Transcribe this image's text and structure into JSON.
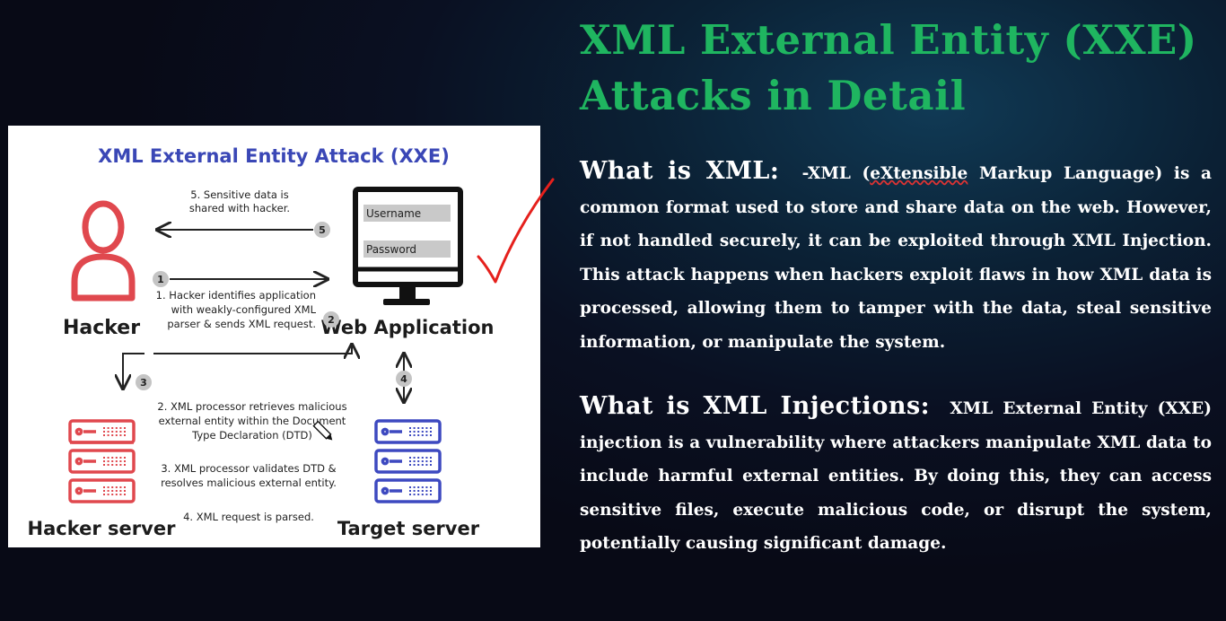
{
  "slide": {
    "title_line1": "XML External Entity (XXE)",
    "title_line2": "Attacks in Detail",
    "section1": {
      "heading": "What is XML:",
      "lead": "-XML (",
      "underlined": "eXtensible",
      "body": " Markup Language) is a common format used to store and share data on the web. However, if not handled securely, it can be exploited through XML Injection. This attack happens when hackers exploit flaws in how XML data is processed, allowing them to tamper with the data, steal sensitive information, or manipulate the system."
    },
    "section2": {
      "heading": "What is XML Injections:",
      "body": "XML External Entity (XXE) injection is a vulnerability where attackers manipulate XML data to include harmful external entities. By doing this, they can access sensitive files, execute malicious code, or disrupt the system, potentially causing significant damage."
    }
  },
  "diagram": {
    "title": "XML External Entity Attack (XXE)",
    "nodes": {
      "hacker": "Hacker",
      "web_app": "Web Application",
      "hacker_server": "Hacker server",
      "target_server": "Target server"
    },
    "login": {
      "username": "Username",
      "password": "Password"
    },
    "steps": {
      "n1": "1",
      "n2": "2",
      "n3": "3",
      "n4": "4",
      "n5": "5",
      "s1_l1": "1. Hacker identifies application",
      "s1_l2": "with weakly-configured XML",
      "s1_l3": "parser & sends XML request.",
      "s2_l1": "2. XML processor retrieves malicious",
      "s2_l2": "external entity within the Document",
      "s2_l3": "Type Declaration (DTD)",
      "s3_l1": "3. XML processor validates DTD &",
      "s3_l2": "resolves malicious external entity.",
      "s4_l1": "4. XML request is parsed.",
      "s5_l1": "5. Sensitive data is",
      "s5_l2": "shared with hacker."
    },
    "colors": {
      "title": "#3a47b6",
      "hacker": "#e0484e",
      "target": "#3d49c0"
    }
  }
}
